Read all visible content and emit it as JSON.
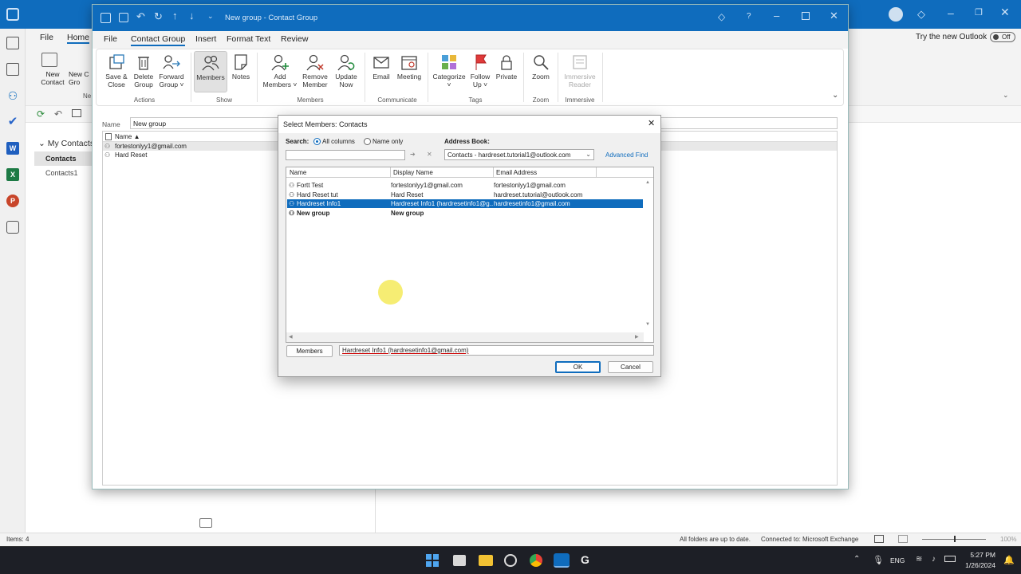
{
  "outlook": {
    "try_new_label": "Try the new Outlook",
    "toggle_label": "Off",
    "tabs": {
      "file": "File",
      "home": "Home"
    },
    "ribbon": {
      "new_contact": "New\nContact",
      "new_contact_group": "New C\nGro",
      "new_group_label": "Ne"
    },
    "folder_header": "My Contacts",
    "folders": [
      "Contacts",
      "Contacts1"
    ],
    "status_items": "Items: 4",
    "status_sync": "All folders are up to date.",
    "status_connection": "Connected to: Microsoft Exchange",
    "zoom": "100%"
  },
  "contact_group": {
    "window_title": "New group  -  Contact Group",
    "tabs": [
      "File",
      "Contact Group",
      "Insert",
      "Format Text",
      "Review"
    ],
    "active_tab": "Contact Group",
    "ribbon": {
      "save_close": "Save &\nClose",
      "delete_group": "Delete\nGroup",
      "forward_group": "Forward\nGroup ˅",
      "members": "Members",
      "notes": "Notes",
      "add_members": "Add\nMembers ˅",
      "remove_member": "Remove\nMember",
      "update_now": "Update\nNow",
      "email": "Email",
      "meeting": "Meeting",
      "categorize": "Categorize\n˅",
      "follow_up": "Follow\nUp ˅",
      "private": "Private",
      "zoom": "Zoom",
      "immersive_reader": "Immersive\nReader",
      "groups": {
        "actions": "Actions",
        "show": "Show",
        "members": "Members",
        "communicate": "Communicate",
        "tags": "Tags",
        "zoom": "Zoom",
        "immersive": "Immersive"
      }
    },
    "name_label": "Name",
    "name_value": "New group",
    "list_header": "Name ▲",
    "members": [
      "fortestonlyy1@gmail.com",
      "Hard Reset"
    ]
  },
  "dialog": {
    "title": "Select Members: Contacts",
    "search_label": "Search:",
    "radio_all": "All columns",
    "radio_name": "Name only",
    "address_book_label": "Address Book:",
    "address_book_value": "Contacts - hardreset.tutorial1@outlook.com",
    "advanced_find": "Advanced Find",
    "search_value": "",
    "columns": [
      "Name",
      "Display Name",
      "Email Address"
    ],
    "rows": [
      {
        "name": "Fortt Test",
        "display": "fortestonlyy1@gmail.com",
        "email": "fortestonlyy1@gmail.com",
        "selected": false,
        "bold": false
      },
      {
        "name": "Hard Reset tut",
        "display": "Hard Reset",
        "email": "hardreset.tutorial@outlook.com",
        "selected": false,
        "bold": false
      },
      {
        "name": "Hardreset Info1",
        "display": "Hardreset Info1 (hardresetinfo1@g...",
        "email": "hardresetinfo1@gmail.com",
        "selected": true,
        "bold": false
      },
      {
        "name": "New group",
        "display": "New group",
        "email": "",
        "selected": false,
        "bold": true
      }
    ],
    "members_button": "Members",
    "members_value": "Hardreset Info1 (hardresetinfo1@gmail.com)",
    "ok": "OK",
    "cancel": "Cancel"
  },
  "taskbar": {
    "lang": "ENG",
    "time": "5:27 PM",
    "date": "1/26/2024"
  },
  "colors": {
    "accent": "#0f6cbd",
    "selection": "#0f6cbd",
    "highlight_cursor": "#f5ea5a"
  }
}
